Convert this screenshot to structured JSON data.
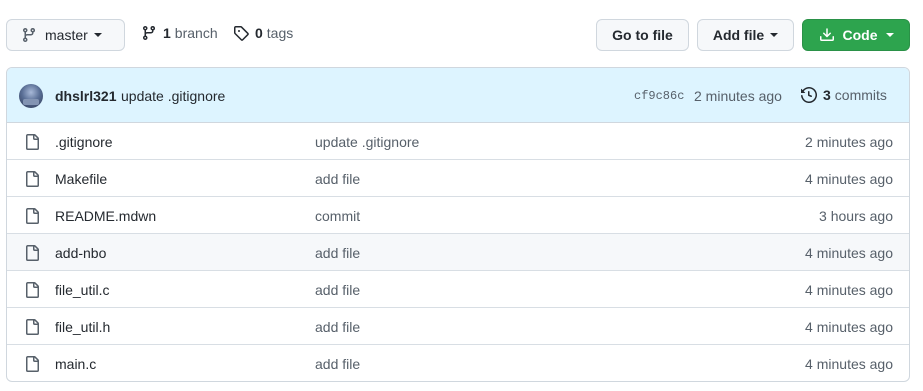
{
  "toolbar": {
    "branch_name": "master",
    "branches_count": "1",
    "branches_label": "branch",
    "tags_count": "0",
    "tags_label": "tags",
    "goto_file_label": "Go to file",
    "add_file_label": "Add file",
    "code_label": "Code"
  },
  "latest_commit": {
    "author": "dhslrl321",
    "message": "update .gitignore",
    "sha": "cf9c86c",
    "time": "2 minutes ago",
    "commits_count": "3",
    "commits_label": "commits"
  },
  "files": [
    {
      "name": ".gitignore",
      "commit": "update .gitignore",
      "time": "2 minutes ago"
    },
    {
      "name": "Makefile",
      "commit": "add file",
      "time": "4 minutes ago"
    },
    {
      "name": "README.mdwn",
      "commit": "commit",
      "time": "3 hours ago"
    },
    {
      "name": "add-nbo",
      "commit": "add file",
      "time": "4 minutes ago"
    },
    {
      "name": "file_util.c",
      "commit": "add file",
      "time": "4 minutes ago"
    },
    {
      "name": "file_util.h",
      "commit": "add file",
      "time": "4 minutes ago"
    },
    {
      "name": "main.c",
      "commit": "add file",
      "time": "4 minutes ago"
    }
  ],
  "colors": {
    "code_button": "#2da44e",
    "commit_bar": "#ddf4ff",
    "border": "#d0d7de"
  },
  "icons": {
    "branch": "git-branch-icon",
    "tag": "tag-icon",
    "download": "download-icon",
    "history": "history-icon",
    "file": "file-icon"
  }
}
